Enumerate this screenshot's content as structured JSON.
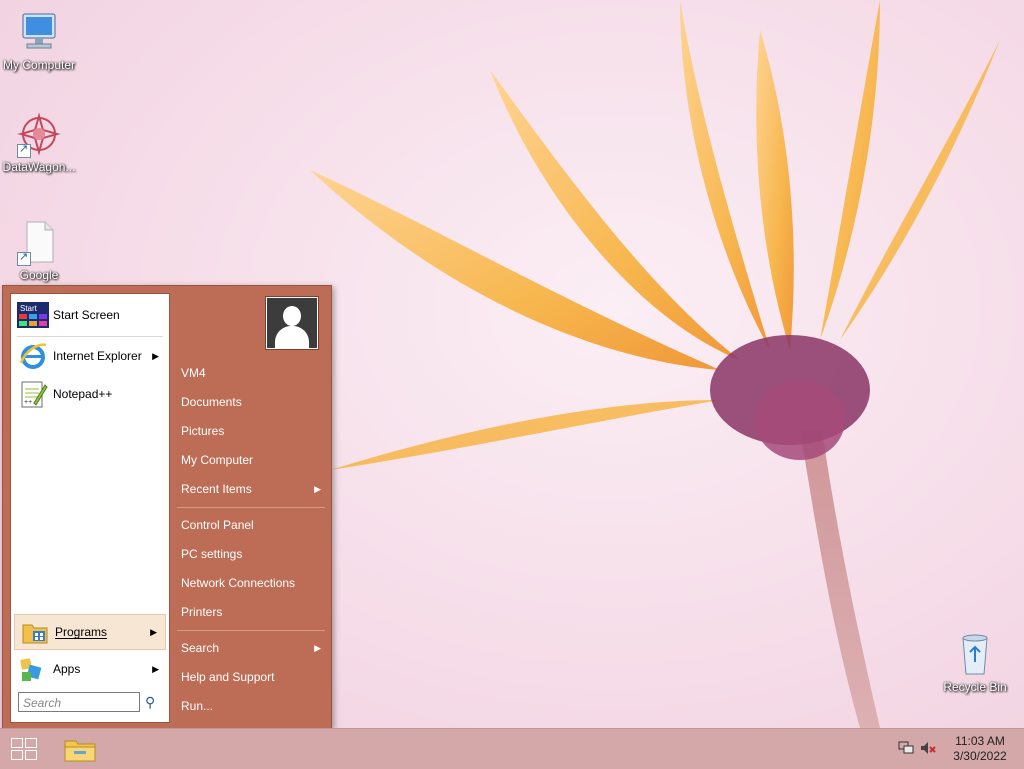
{
  "desktop": {
    "icons": [
      {
        "label": "My Computer"
      },
      {
        "label": "DataWagon..."
      },
      {
        "label": "Google"
      },
      {
        "label": "Recycle Bin"
      }
    ]
  },
  "start_menu": {
    "left": {
      "pinned": [
        {
          "label": "Start Screen",
          "icon": "start-screen-icon",
          "icon_text": "Start"
        },
        {
          "label": "Internet Explorer",
          "icon": "internet-explorer-icon",
          "has_submenu": true
        },
        {
          "label": "Notepad++",
          "icon": "notepad-plus-plus-icon"
        }
      ],
      "programs_label": "Programs",
      "apps_label": "Apps",
      "search_placeholder": "Search"
    },
    "right": {
      "items": [
        {
          "label": "VM4"
        },
        {
          "label": "Documents"
        },
        {
          "label": "Pictures"
        },
        {
          "label": "My Computer"
        },
        {
          "label": "Recent Items",
          "has_submenu": true
        },
        {
          "label": "Control Panel"
        },
        {
          "label": "PC settings"
        },
        {
          "label": "Network Connections"
        },
        {
          "label": "Printers"
        },
        {
          "label": "Search",
          "has_submenu": true
        },
        {
          "label": "Help and Support"
        },
        {
          "label": "Run..."
        }
      ]
    }
  },
  "taskbar": {
    "clock_time": "11:03 AM",
    "clock_date": "3/30/2022"
  },
  "colors": {
    "start_menu_bg": "#bd6d55",
    "taskbar_bg": "#d4a7a8",
    "flower_petal": "#f6b33a",
    "flower_center": "#8a3566"
  }
}
